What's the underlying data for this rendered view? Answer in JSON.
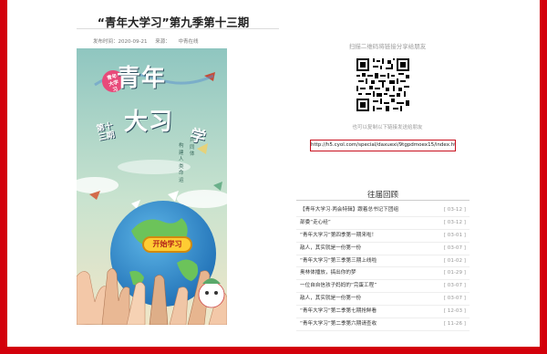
{
  "article": {
    "title": "“青年大学习”第九季第十三期",
    "meta": {
      "published_label": "发布时间：2020-09-21",
      "source_label": "来源：",
      "source_name": "中青在线"
    }
  },
  "poster": {
    "badge": "青年\n大学\n习",
    "title_line1": "青年",
    "title_line2": "大习",
    "title_xue": "学",
    "subtitle": "第十\n三期",
    "slogan_a": "构建人类命运",
    "slogan_b": "共同体",
    "button": "开始学习"
  },
  "share": {
    "scan_text": "扫描二维码将链接分享给朋友",
    "copy_text": "也可以复制以下链接发送给朋友",
    "url": "http://h5.cyol.com/special/daxuexi/9tgpdmoex15/index.html"
  },
  "past": {
    "title": "往届回顾",
    "items": [
      {
        "title": "【青年大学习·两会特辑】跟着总书记下团组",
        "date": "[ 03-12 ]"
      },
      {
        "title": "部委“走心经”",
        "date": "[ 03-12 ]"
      },
      {
        "title": "“青年大学习”第四季第一期来啦！",
        "date": "[ 03-01 ]"
      },
      {
        "title": "敌人，其实就是一份第一份",
        "date": "[ 03-07 ]"
      },
      {
        "title": "“青年大学习”第三季第三期上线啦",
        "date": "[ 01-02 ]"
      },
      {
        "title": "奥林体播放，搞出你的梦",
        "date": "[ 01-29 ]"
      },
      {
        "title": "一位自自信孩子妈妈的“完蛋工程”",
        "date": "[ 03-07 ]"
      },
      {
        "title": "敌人，其实就是一份第一份",
        "date": "[ 03-07 ]"
      },
      {
        "title": "“青年大学习”第二季第七期抢鲜看",
        "date": "[ 12-03 ]"
      },
      {
        "title": "“青年大学习”第二季第六期请查收",
        "date": "[ 11-26 ]"
      }
    ]
  },
  "colors": {
    "frame": "#d3000b",
    "poster_bg": "#9cc9bf",
    "button_bg": "#ffcc33"
  }
}
